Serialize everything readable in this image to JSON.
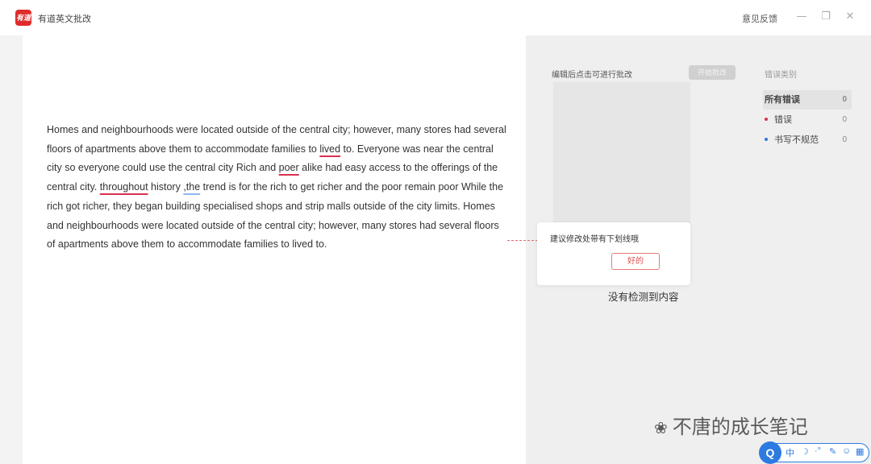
{
  "app": {
    "logo_text": "有道",
    "title": "有道英文批改",
    "feedback": "意见反馈",
    "minimize_glyph": "—",
    "maximize_glyph": "❐",
    "close_glyph": "✕"
  },
  "essay": {
    "t1": "Homes and neighbourhoods were located outside of the central city; however, many stores had several floors of apartments above them to accommodate families to ",
    "e1": "lived",
    "t2": " to. Everyone was near the central city so everyone could use the central city Rich and ",
    "e2": "poer",
    "t3": " alike had easy access to the offerings of the central city. ",
    "e3": "throughout",
    "t4": " history ",
    "e4": ",the",
    "t5": " trend is for the rich to get richer and the poor remain poor While the rich got richer, they began building specialised shops and strip malls outside of the city limits. Homes and neighbourhoods were located outside of the central city; however, many stores had several floors of apartments above them to accommodate families to lived to."
  },
  "panel": {
    "prompt": "编辑后点击可进行批改",
    "revise_button": "开始批改",
    "error_type_header": "错误类别",
    "categories": [
      {
        "label": "所有错误",
        "count": "0"
      },
      {
        "label": "错误",
        "count": "0",
        "color": "#d9304f"
      },
      {
        "label": "书写不规范",
        "count": "0",
        "color": "#3a74d8"
      }
    ],
    "popup_text": "建议修改处带有下划线哦",
    "popup_button": "好的",
    "empty_text": "没有检测到内容"
  },
  "watermark": {
    "icon": "wechat-icon",
    "icon_glyph": "❀",
    "text": "不唐的成长笔记"
  },
  "ime": {
    "logo": "Q",
    "items": [
      "中",
      "☽",
      "·°",
      "✎",
      "☺",
      "▦"
    ]
  }
}
